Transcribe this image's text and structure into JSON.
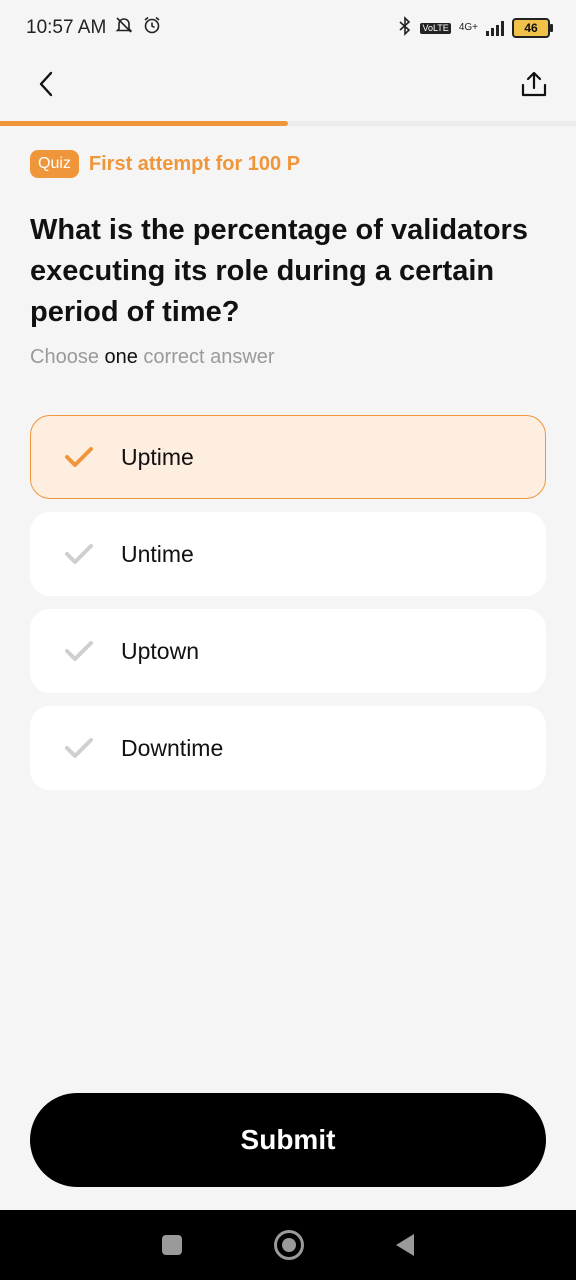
{
  "status_bar": {
    "time": "10:57 AM",
    "network": "4G+",
    "network_sub": "VoLTE",
    "battery": "46"
  },
  "progress": {
    "fraction": 0.5,
    "color": "#f0963a"
  },
  "quiz": {
    "badge": "Quiz",
    "reward": "First attempt for 100 P"
  },
  "question": {
    "text": "What is the percentage of validators executing its role during a certain period of time?",
    "instruction_pre": "Choose ",
    "instruction_emph": "one",
    "instruction_post": " correct answer"
  },
  "options": [
    {
      "label": "Uptime",
      "selected": true
    },
    {
      "label": "Untime",
      "selected": false
    },
    {
      "label": "Uptown",
      "selected": false
    },
    {
      "label": "Downtime",
      "selected": false
    }
  ],
  "submit_label": "Submit",
  "colors": {
    "accent": "#f0963a",
    "selected_bg": "#fdeee0",
    "check_inactive": "#cfcfcf"
  },
  "icons": {
    "back": "chevron-left-icon",
    "share": "share-icon",
    "check": "checkmark-icon"
  }
}
